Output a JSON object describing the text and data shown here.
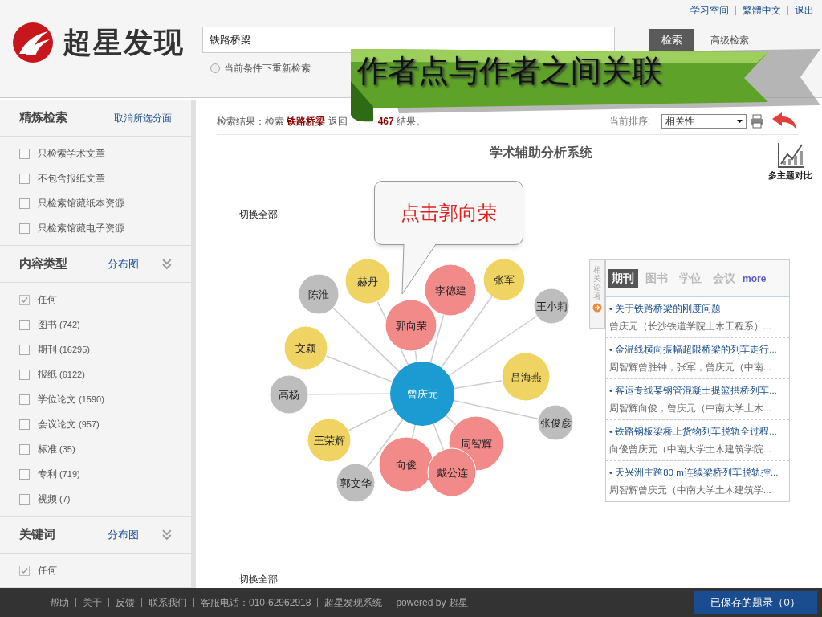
{
  "top_links": [
    "学习空间",
    "繁體中文",
    "退出"
  ],
  "logo": {
    "text": "超星发现"
  },
  "search": {
    "value": "铁路桥梁",
    "button": "检索",
    "advanced": "高级检索",
    "option": {
      "label": "当前条件下重新检索",
      "selected": false
    }
  },
  "banner": {
    "text": "作者点与作者之间关联"
  },
  "sidebar": {
    "title": "精炼检索",
    "clear": "取消所选分面",
    "filters": [
      {
        "label": "只检索学术文章",
        "checked": false
      },
      {
        "label": "不包含报纸文章",
        "checked": false
      },
      {
        "label": "只检索馆藏纸本资源",
        "checked": false
      },
      {
        "label": "只检索馆藏电子资源",
        "checked": false
      }
    ],
    "sections": [
      {
        "title": "内容类型",
        "link": "分布图",
        "items": [
          {
            "label": "任何",
            "checked": true
          },
          {
            "label": "图书",
            "count": "(742)",
            "checked": false
          },
          {
            "label": "期刊",
            "count": "(16295)",
            "checked": false
          },
          {
            "label": "报纸",
            "count": "(6122)",
            "checked": false
          },
          {
            "label": "学位论文",
            "count": "(1590)",
            "checked": false
          },
          {
            "label": "会议论文",
            "count": "(957)",
            "checked": false
          },
          {
            "label": "标准",
            "count": "(35)",
            "checked": false
          },
          {
            "label": "专利",
            "count": "(719)",
            "checked": false
          },
          {
            "label": "视频",
            "count": "(7)",
            "checked": false
          }
        ]
      },
      {
        "title": "关键词",
        "link": "分布图",
        "items": [
          {
            "label": "任何",
            "checked": true
          }
        ]
      }
    ]
  },
  "results": {
    "label": "检索结果：检索",
    "query": "铁路桥梁",
    "returned": "返回",
    "count": "467",
    "suffix": "结果。",
    "sort_label": "当前排序:",
    "sort_value": "相关性"
  },
  "analysis": {
    "title": "学术辅助分析系统",
    "compare": "多主题对比",
    "toggle_top": "切换全部",
    "toggle_bottom": "切换全部",
    "callout": "点击郭向荣",
    "center": {
      "name": "曾庆元",
      "color": "#1b9bd1"
    },
    "authors": [
      {
        "name": "陈淮",
        "color": "#bdbdbd"
      },
      {
        "name": "赫丹",
        "color": "#f0d463"
      },
      {
        "name": "李德建",
        "color": "#f28a8a"
      },
      {
        "name": "张军",
        "color": "#f0d463"
      },
      {
        "name": "王小莉",
        "color": "#bdbdbd"
      },
      {
        "name": "郭向荣",
        "color": "#f28a8a"
      },
      {
        "name": "文颖",
        "color": "#f0d463"
      },
      {
        "name": "吕海燕",
        "color": "#f0d463"
      },
      {
        "name": "高杨",
        "color": "#bdbdbd"
      },
      {
        "name": "张俊彦",
        "color": "#bdbdbd"
      },
      {
        "name": "王荣辉",
        "color": "#f0d463"
      },
      {
        "name": "周智辉",
        "color": "#f28a8a"
      },
      {
        "name": "向俊",
        "color": "#f28a8a"
      },
      {
        "name": "戴公连",
        "color": "#f28a8a"
      },
      {
        "name": "郭文华",
        "color": "#bdbdbd"
      }
    ]
  },
  "related": {
    "side_label": "相关论著",
    "more": "more",
    "tabs": [
      {
        "label": "期刊",
        "selected": true
      },
      {
        "label": "图书",
        "selected": false
      },
      {
        "label": "学位",
        "selected": false
      },
      {
        "label": "会议",
        "selected": false
      }
    ],
    "items": [
      {
        "title": "• 关于铁路桥梁的刚度问题",
        "authors": "曾庆元（长沙铁道学院土木工程系）..."
      },
      {
        "title": "• 金温线横向振幅超限桥梁的列车走行...",
        "authors": "周智辉曾胜钟，张军，曾庆元（中南..."
      },
      {
        "title": "• 客运专线某钢管混凝土提篮拱桥列车...",
        "authors": "周智辉向俊，曾庆元（中南大学土木..."
      },
      {
        "title": "• 铁路钢板梁桥上货物列车脱轨全过程...",
        "authors": "向俊曾庆元（中南大学土木建筑学院..."
      },
      {
        "title": "• 天兴洲主跨80 m连续梁桥列车脱轨控...",
        "authors": "周智辉曾庆元（中南大学土木建筑学..."
      }
    ]
  },
  "footer": {
    "links": [
      "帮助",
      "关于",
      "反馈",
      "联系我们",
      "客服电话：010-62962918",
      "超星发现系统",
      "powered by 超星"
    ],
    "saved": "已保存的题录（0）"
  }
}
